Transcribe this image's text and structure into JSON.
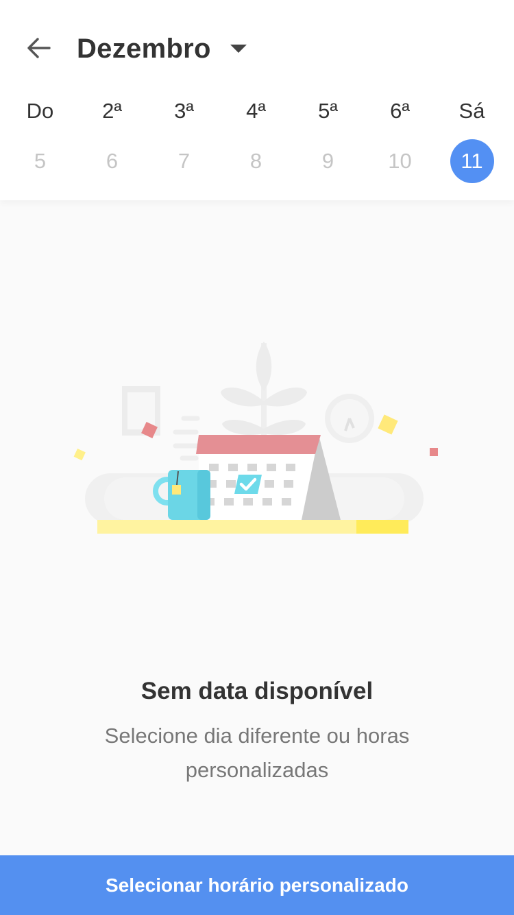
{
  "header": {
    "back_icon": "arrow-left-icon",
    "month": "Dezembro",
    "dropdown_icon": "caret-down-icon"
  },
  "calendar": {
    "weekdays": [
      "Do",
      "2ª",
      "3ª",
      "4ª",
      "5ª",
      "6ª",
      "Sá"
    ],
    "days": [
      "5",
      "6",
      "7",
      "8",
      "9",
      "10",
      "11"
    ],
    "selected_day": "11",
    "selected_color": "#5390f3"
  },
  "empty_state": {
    "illustration": "calendar-with-mug-illustration",
    "title": "Sem data disponível",
    "subtitle": "Selecione dia diferente ou horas personalizadas"
  },
  "footer": {
    "button_label": "Selecionar horário personalizado",
    "button_color": "#5490f0"
  }
}
